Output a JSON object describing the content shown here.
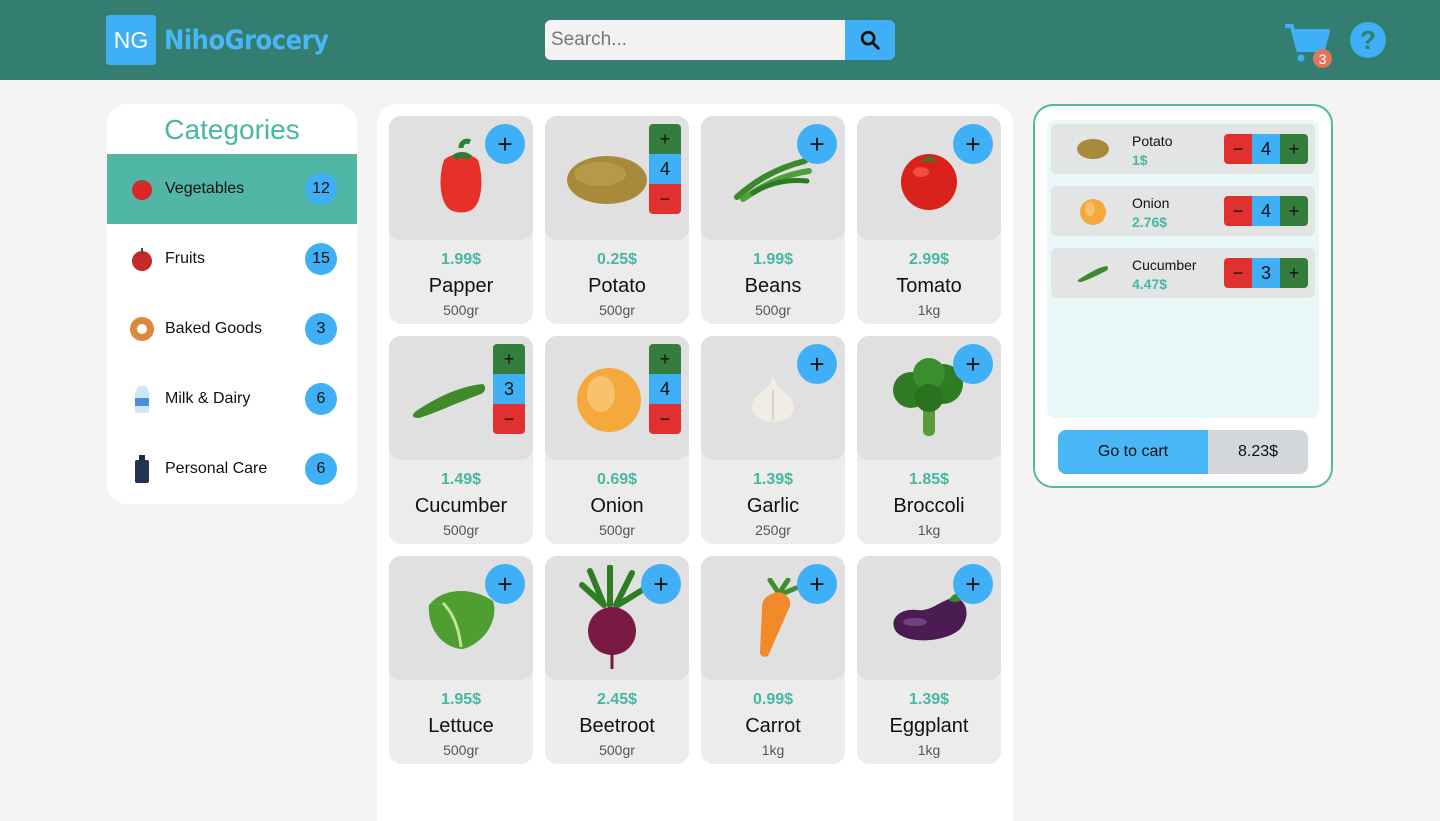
{
  "app": {
    "logo_initials": "NG",
    "logo_name": "NihoGrocery"
  },
  "search": {
    "placeholder": "Search..."
  },
  "cart_badge": "3",
  "help_label": "?",
  "categories": {
    "title": "Categories",
    "items": [
      {
        "label": "Vegetables",
        "count": "12",
        "icon": "tomato-icon",
        "active": true
      },
      {
        "label": "Fruits",
        "count": "15",
        "icon": "apple-icon"
      },
      {
        "label": "Baked Goods",
        "count": "3",
        "icon": "bagel-icon"
      },
      {
        "label": "Milk & Dairy",
        "count": "6",
        "icon": "milk-carton-icon"
      },
      {
        "label": "Personal Care",
        "count": "6",
        "icon": "bottle-icon"
      }
    ]
  },
  "products": [
    {
      "name": "Papper",
      "price": "1.99$",
      "weight": "500gr",
      "icon": "pepper-icon"
    },
    {
      "name": "Potato",
      "price": "0.25$",
      "weight": "500gr",
      "icon": "potato-icon",
      "qty": "4"
    },
    {
      "name": "Beans",
      "price": "1.99$",
      "weight": "500gr",
      "icon": "beans-icon"
    },
    {
      "name": "Tomato",
      "price": "2.99$",
      "weight": "1kg",
      "icon": "tomato-icon"
    },
    {
      "name": "Cucumber",
      "price": "1.49$",
      "weight": "500gr",
      "icon": "cucumber-icon",
      "qty": "3"
    },
    {
      "name": "Onion",
      "price": "0.69$",
      "weight": "500gr",
      "icon": "onion-icon",
      "qty": "4"
    },
    {
      "name": "Garlic",
      "price": "1.39$",
      "weight": "250gr",
      "icon": "garlic-icon"
    },
    {
      "name": "Broccoli",
      "price": "1.85$",
      "weight": "1kg",
      "icon": "broccoli-icon"
    },
    {
      "name": "Lettuce",
      "price": "1.95$",
      "weight": "500gr",
      "icon": "lettuce-icon"
    },
    {
      "name": "Beetroot",
      "price": "2.45$",
      "weight": "500gr",
      "icon": "beetroot-icon"
    },
    {
      "name": "Carrot",
      "price": "0.99$",
      "weight": "1kg",
      "icon": "carrot-icon"
    },
    {
      "name": "Eggplant",
      "price": "1.39$",
      "weight": "1kg",
      "icon": "eggplant-icon"
    }
  ],
  "cart": {
    "items": [
      {
        "name": "Potato",
        "price": "1$",
        "qty": "4"
      },
      {
        "name": "Onion",
        "price": "2.76$",
        "qty": "4"
      },
      {
        "name": "Cucumber",
        "price": "4.47$",
        "qty": "3"
      }
    ],
    "go_label": "Go to cart",
    "total": "8.23$"
  },
  "labels": {
    "plus": "+",
    "minus": "−"
  },
  "colors": {
    "header": "#347d71",
    "accent": "#3fb0f5",
    "teal": "#52b6a6",
    "price": "#48b6a3",
    "plus": "#347d3c",
    "minus": "#e03030"
  }
}
